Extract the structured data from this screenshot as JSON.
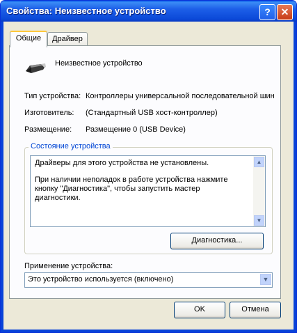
{
  "window": {
    "title": "Свойства: Неизвестное устройство",
    "help_glyph": "?",
    "close_glyph": "✕"
  },
  "tabs": [
    {
      "label": "Общие",
      "active": true
    },
    {
      "label": "Драйвер",
      "active": false
    }
  ],
  "device": {
    "name": "Неизвестное устройство",
    "icon": "usb-connector-icon",
    "rows": [
      {
        "label": "Тип устройства:",
        "value": "Контроллеры универсальной последовательной шин"
      },
      {
        "label": "Изготовитель:",
        "value": "(Стандартный USB хост-контроллер)"
      },
      {
        "label": "Размещение:",
        "value": "Размещение 0 (USB Device)"
      }
    ]
  },
  "status": {
    "group_title": "Состояние устройства",
    "line1": "Драйверы для этого устройства не установлены.",
    "line2": "При наличии неполадок в работе устройства нажмите кнопку \"Диагностика\", чтобы запустить мастер диагностики.",
    "diagnostics_button": "Диагностика..."
  },
  "usage": {
    "label": "Применение устройства:",
    "value": "Это устройство используется (включено)"
  },
  "buttons": {
    "ok": "OK",
    "cancel": "Отмена"
  },
  "colors": {
    "titlebar": "#0b49d8",
    "group_title": "#0046d5",
    "tab_highlight": "#ffc83c"
  }
}
